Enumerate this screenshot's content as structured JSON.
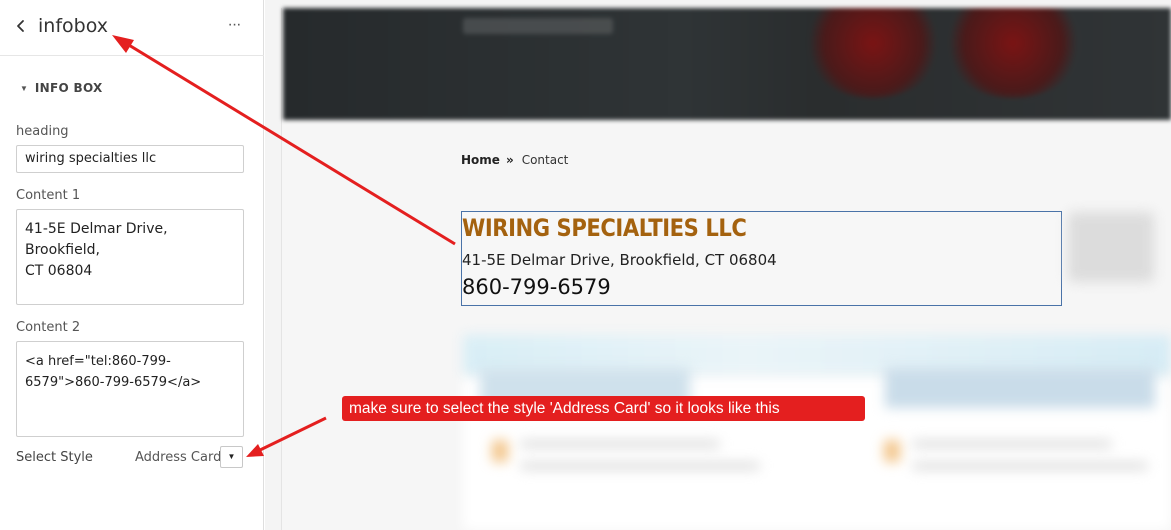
{
  "panel": {
    "title": "infobox",
    "more_label": "···",
    "section_label": "INFO BOX",
    "fields": {
      "heading_label": "heading",
      "heading_value": "wiring specialties llc",
      "content1_label": "Content 1",
      "content1_value": "41-5E Delmar Drive, Brookfield,\nCT 06804",
      "content2_label": "Content 2",
      "content2_value": "<a href=\"tel:860-799-\n6579\">860-799-6579</a>"
    },
    "style": {
      "label": "Select Style",
      "selected": "Address Card",
      "dropdown_glyph": "▼"
    }
  },
  "preview": {
    "breadcrumb": {
      "home": "Home",
      "separator": "»",
      "current": "Contact"
    },
    "infobox": {
      "heading": "WIRING SPECIALTIES LLC",
      "address": "41-5E Delmar Drive, Brookfield, CT 06804",
      "phone": "860-799-6579"
    }
  },
  "annotation": {
    "callout_text": "make sure to select the style 'Address Card' so it looks like this"
  },
  "colors": {
    "heading_accent": "#a4620f",
    "annotation_red": "#e41f1f",
    "infobox_border": "#4a73a8"
  }
}
